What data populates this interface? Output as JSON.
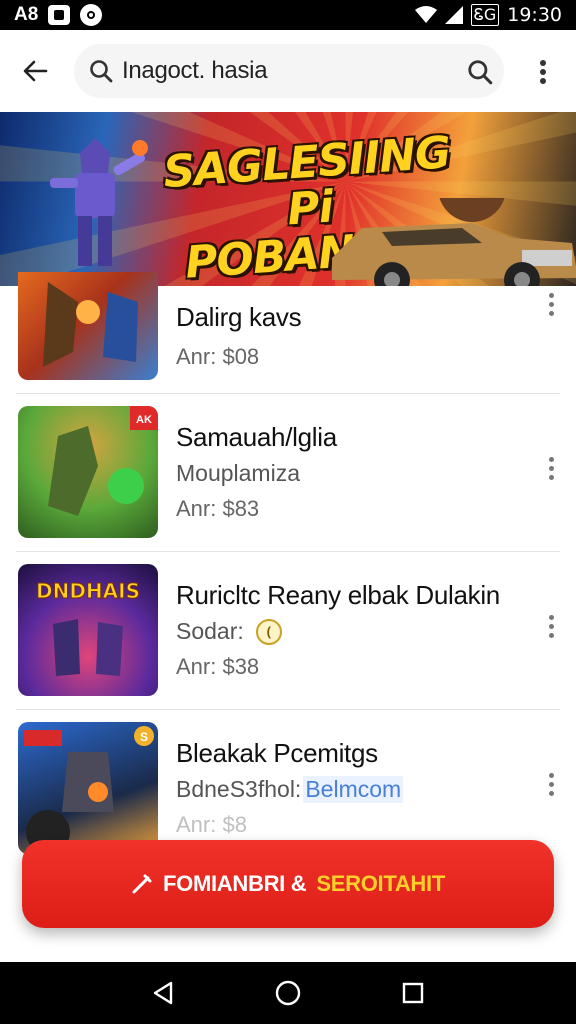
{
  "status_bar": {
    "left_text": "A8",
    "time": "19:30",
    "battery_label": "ᏋG"
  },
  "app_bar": {
    "search_text": "Inagoct. hasia"
  },
  "banner": {
    "title_line1": "SAGLESIING",
    "title_line2": "Pi POBANGA!"
  },
  "items": [
    {
      "title": "Dalirg kavs",
      "subtitle": "",
      "price": "Anr: $08",
      "thumb_colors": [
        "#e56a1f",
        "#3a7fd0"
      ]
    },
    {
      "title": "Samauah/lglia",
      "subtitle": "Mouplamiza",
      "price": "Anr: $83",
      "badge": "AK",
      "thumb_colors": [
        "#5aa83a",
        "#d3a441"
      ]
    },
    {
      "title": "Ruricltc Reany elbak Dulakin",
      "subtitle": "Sodar:",
      "price": "Anr: $38",
      "badge_text": "DNDHAIS",
      "thumb_colors": [
        "#5a2a9c",
        "#e0457a"
      ]
    },
    {
      "title": "Bleakak Pcemitgs",
      "subtitle": "BdneS3fhol:",
      "subtitle_link": "Belmcom",
      "price": "Anr: $8",
      "badge": "S",
      "thumb_colors": [
        "#2c6ad0",
        "#f3a53a"
      ]
    }
  ],
  "fab": {
    "label_white": "FOMIANBRI &",
    "label_yellow": "SEROITAHIT"
  },
  "colors": {
    "accent_red": "#e2231a",
    "accent_yellow": "#ffd21f"
  }
}
